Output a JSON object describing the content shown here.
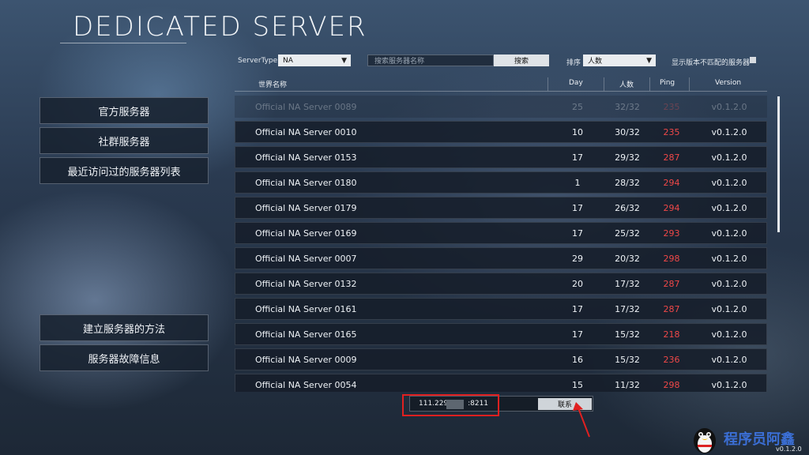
{
  "page": {
    "title": "DEDICATED SERVER"
  },
  "nav": {
    "official": "官方服务器",
    "community": "社群服务器",
    "recent": "最近访问过的服务器列表",
    "howto": "建立服务器的方法",
    "troubleshoot": "服务器故障信息"
  },
  "filters": {
    "server_type_label": "ServerType",
    "server_type_value": "NA",
    "search_placeholder": "搜索服务器名称",
    "search_button": "搜索",
    "sort_label": "排序",
    "sort_value": "人数",
    "show_mismatch_label": "显示版本不匹配的服务器"
  },
  "table": {
    "headers": {
      "name": "世界名称",
      "day": "Day",
      "players": "人数",
      "ping": "Ping",
      "version": "Version"
    },
    "rows": [
      {
        "name": "Official NA Server 0089",
        "day": "25",
        "players": "32/32",
        "ping": "235",
        "version": "v0.1.2.0"
      },
      {
        "name": "Official NA Server 0010",
        "day": "10",
        "players": "30/32",
        "ping": "235",
        "version": "v0.1.2.0"
      },
      {
        "name": "Official NA Server 0153",
        "day": "17",
        "players": "29/32",
        "ping": "287",
        "version": "v0.1.2.0"
      },
      {
        "name": "Official NA Server 0180",
        "day": "1",
        "players": "28/32",
        "ping": "294",
        "version": "v0.1.2.0"
      },
      {
        "name": "Official NA Server 0179",
        "day": "17",
        "players": "26/32",
        "ping": "294",
        "version": "v0.1.2.0"
      },
      {
        "name": "Official NA Server 0169",
        "day": "17",
        "players": "25/32",
        "ping": "293",
        "version": "v0.1.2.0"
      },
      {
        "name": "Official NA Server 0007",
        "day": "29",
        "players": "20/32",
        "ping": "298",
        "version": "v0.1.2.0"
      },
      {
        "name": "Official NA Server 0132",
        "day": "20",
        "players": "17/32",
        "ping": "287",
        "version": "v0.1.2.0"
      },
      {
        "name": "Official NA Server 0161",
        "day": "17",
        "players": "17/32",
        "ping": "287",
        "version": "v0.1.2.0"
      },
      {
        "name": "Official NA Server 0165",
        "day": "17",
        "players": "15/32",
        "ping": "218",
        "version": "v0.1.2.0"
      },
      {
        "name": "Official NA Server 0009",
        "day": "16",
        "players": "15/32",
        "ping": "236",
        "version": "v0.1.2.0"
      },
      {
        "name": "Official NA Server 0054",
        "day": "15",
        "players": "11/32",
        "ping": "298",
        "version": "v0.1.2.0"
      }
    ]
  },
  "connect": {
    "ip_prefix": "111.229.",
    "ip_suffix": ":8211",
    "button": "联系"
  },
  "footer": {
    "watermark": "程序员阿鑫",
    "version": "v0.1.2.0"
  },
  "colors": {
    "ping": "#f04848",
    "highlight": "#e02020",
    "watermark": "#3b6fd6"
  }
}
